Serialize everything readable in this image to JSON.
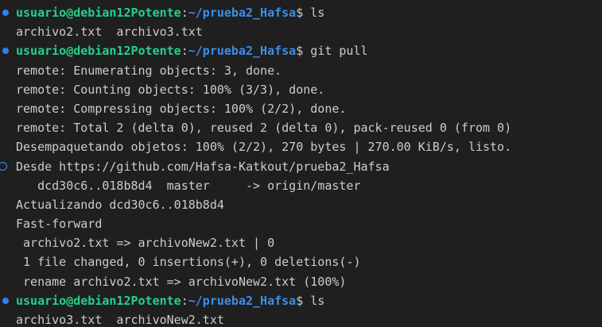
{
  "prompt": {
    "user_host": "usuario@debian12Potente",
    "separator": ":",
    "path": "~/prueba2_Hafsa",
    "symbol": "$"
  },
  "lines": [
    {
      "type": "prompt",
      "command": " ls",
      "marker": "success"
    },
    {
      "type": "output",
      "text": "archivo2.txt  archivo3.txt"
    },
    {
      "type": "prompt",
      "command": " git pull",
      "marker": "success"
    },
    {
      "type": "output",
      "text": "remote: Enumerating objects: 3, done."
    },
    {
      "type": "output",
      "text": "remote: Counting objects: 100% (3/3), done."
    },
    {
      "type": "output",
      "text": "remote: Compressing objects: 100% (2/2), done."
    },
    {
      "type": "output",
      "text": "remote: Total 2 (delta 0), reused 2 (delta 0), pack-reused 0 (from 0)"
    },
    {
      "type": "output",
      "text": "Desempaquetando objetos: 100% (2/2), 270 bytes | 270.00 KiB/s, listo."
    },
    {
      "type": "output",
      "text": "Desde https://github.com/Hafsa-Katkout/prueba2_Hafsa",
      "marker": "hollow"
    },
    {
      "type": "output",
      "text": "   dcd30c6..018b8d4  master     -> origin/master"
    },
    {
      "type": "output",
      "text": "Actualizando dcd30c6..018b8d4"
    },
    {
      "type": "output",
      "text": "Fast-forward"
    },
    {
      "type": "output",
      "text": " archivo2.txt => archivoNew2.txt | 0"
    },
    {
      "type": "output",
      "text": " 1 file changed, 0 insertions(+), 0 deletions(-)"
    },
    {
      "type": "output",
      "text": " rename archivo2.txt => archivoNew2.txt (100%)"
    },
    {
      "type": "prompt",
      "command": " ls",
      "marker": "success"
    },
    {
      "type": "output",
      "text": "archivo3.txt  archivoNew2.txt"
    }
  ],
  "colors": {
    "background": "#1f1f1f",
    "user_host": "#23d18b",
    "path": "#3b8eea",
    "text": "#cccccc",
    "success_marker": "#2f80ed"
  }
}
